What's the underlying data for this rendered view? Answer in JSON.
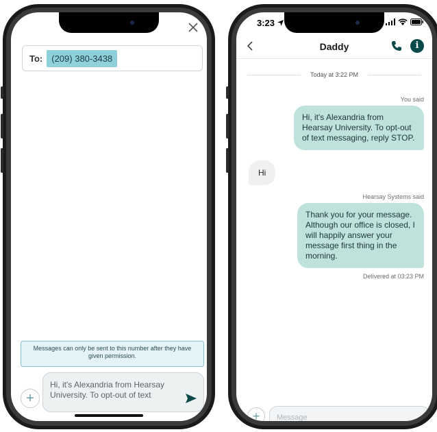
{
  "left_screen": {
    "to_label": "To:",
    "recipient": "(209) 380-3438",
    "permission_notice": "Messages can only be sent to this number after they have given permission.",
    "compose_text": "Hi, it's Alexandria from Hearsay University. To opt-out of text",
    "icons": [
      "close-icon",
      "plus-icon",
      "send-icon"
    ]
  },
  "right_screen": {
    "status_time": "3:23",
    "contact_name": "Daddy",
    "date_divider": "Today at 3:22 PM",
    "messages": [
      {
        "direction": "outgoing",
        "sender": "You said",
        "text": "Hi, it's Alexandria from Hearsay University. To opt-out of text messaging, reply STOP."
      },
      {
        "direction": "incoming",
        "text": "Hi"
      },
      {
        "direction": "outgoing",
        "sender": "Hearsay Systems said",
        "text": "Thank you for your message. Although our office is closed, I will happily answer your message first thing in the morning.",
        "status": "Delivered at 03:23 PM"
      }
    ],
    "compose_placeholder": "Message",
    "icons": [
      "back-icon",
      "phone-icon",
      "info-icon",
      "location-arrow-icon",
      "signal-icon",
      "wifi-icon",
      "battery-icon"
    ]
  },
  "colors": {
    "outgoing_bubble": "#bfe2dc",
    "incoming_bubble": "#eef0f1",
    "accent": "#0b4a4a",
    "recipient_chip": "#8fd0db",
    "notice_border": "#7cc2d2"
  }
}
